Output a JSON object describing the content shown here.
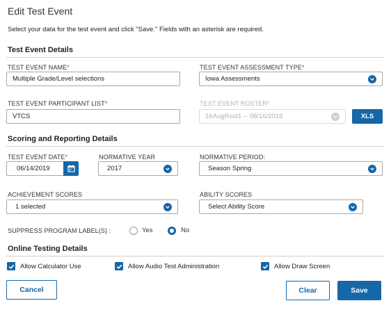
{
  "dialog": {
    "title": "Edit Test Event",
    "instructions": "Select your data for the test event and click \"Save.\" Fields with an asterisk are required."
  },
  "details": {
    "heading": "Test Event Details",
    "name_label": "TEST EVENT NAME",
    "name_value": "Multiple Grade/Level selections",
    "assessment_type_label": "TEST EVENT ASSESSMENT TYPE",
    "assessment_type_value": "Iowa Assessments",
    "participant_list_label": "TEST EVENT PARTICIPANT LIST",
    "participant_list_value": "VTCS",
    "roster_label": "TEST EVENT ROSTER",
    "roster_value": "16AugRost1 -- 08/16/2018",
    "xls_button": "XLS",
    "asterisk": "*"
  },
  "scoring": {
    "heading": "Scoring and Reporting Details",
    "date_label": "TEST EVENT DATE",
    "date_value": "06/14/2019",
    "norm_year_label": "NORMATIVE YEAR",
    "norm_year_value": "2017",
    "norm_period_label": "NORMATIVE PERIOD:",
    "norm_period_value": "Season Spring",
    "achievement_label": "ACHIEVEMENT SCORES",
    "achievement_value": "1 selected",
    "ability_label": "ABILITY SCORES",
    "ability_value": "Select Ability Score",
    "suppress_label": "SUPPRESS PROGRAM LABEL(S) :",
    "suppress_yes": "Yes",
    "suppress_no": "No",
    "suppress_selected": "No"
  },
  "online": {
    "heading": "Online Testing Details",
    "calculator": "Allow Calculator Use",
    "audio": "Allow Audio Test Administration",
    "draw": "Allow Draw Screen",
    "calculator_checked": true,
    "audio_checked": true,
    "draw_checked": true
  },
  "footer": {
    "cancel": "Cancel",
    "clear": "Clear",
    "save": "Save"
  },
  "colors": {
    "accent": "#1766a8",
    "required": "#c0392b"
  }
}
